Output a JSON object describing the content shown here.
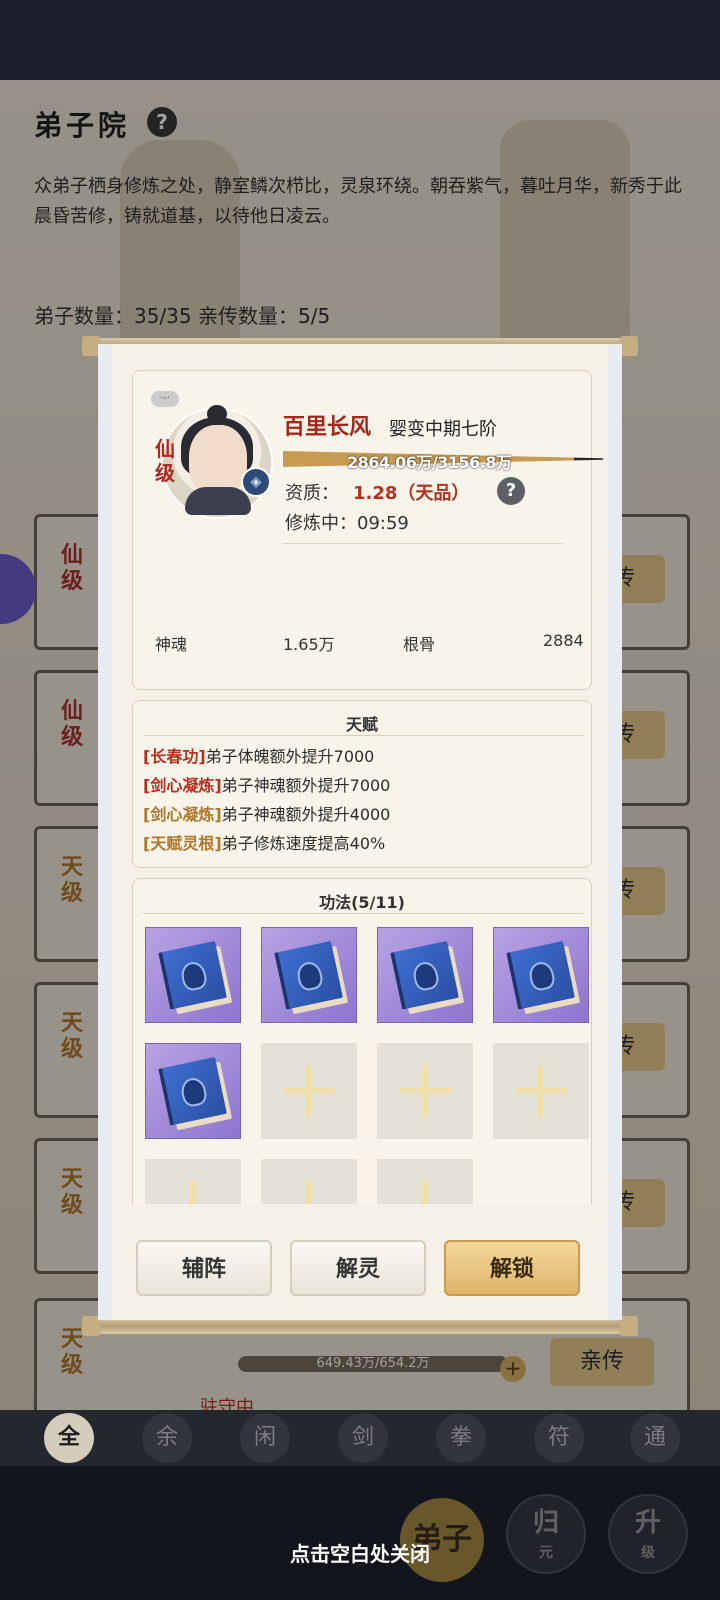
{
  "background": {
    "title": "弟子院",
    "description": "众弟子栖身修炼之处，静室鳞次栉比，灵泉环绕。朝吞紫气，暮吐月华，新秀于此晨昏苦修，铸就道基，以待他日凌云。",
    "count_text": "弟子数量：35/35   亲传数量：5/5",
    "cards": [
      {
        "rank": "仙级",
        "button": "亲传"
      },
      {
        "rank": "仙级",
        "button": "亲传"
      },
      {
        "rank": "天级",
        "button": "亲传"
      },
      {
        "rank": "天级",
        "button": "亲传"
      },
      {
        "rank": "天级",
        "button": "亲传"
      }
    ],
    "last_card": {
      "rank": "天级",
      "exp_text": "649.43万/654.2万",
      "status": "驻守中...",
      "button": "亲传"
    },
    "filters": [
      "全",
      "余",
      "闲",
      "剑",
      "拳",
      "符",
      "通"
    ],
    "bottom_nav": {
      "dizi": "弟子",
      "guiyuan": {
        "main": "归",
        "sub": "元"
      },
      "shengji": {
        "main": "升",
        "sub": "级"
      }
    },
    "close_hint": "点击空白处关闭"
  },
  "disciple": {
    "rank": "仙级",
    "name": "百里长风",
    "realm": "婴变中期七阶",
    "exp_text": "2864.06万/3156.8万",
    "exp_fraction": 0.907,
    "aptitude_label": "资质：",
    "aptitude_value": "1.28（天品）",
    "status_label": "修炼中：09:59",
    "stats": [
      {
        "label": "神魂",
        "value": "1.65万"
      },
      {
        "label": "根骨",
        "value": "2884"
      }
    ]
  },
  "talents": {
    "title": "天赋",
    "items": [
      {
        "tag": "[长春功]",
        "text": "弟子体魄额外提升7000",
        "color": "#b5301f"
      },
      {
        "tag": "[剑心凝炼]",
        "text": "弟子神魂额外提升7000",
        "color": "#b5301f"
      },
      {
        "tag": "[剑心凝炼]",
        "text": "弟子神魂额外提升4000",
        "color": "#b0762a"
      },
      {
        "tag": "[天赋灵根]",
        "text": "弟子修炼速度提高40%",
        "color": "#b0762a"
      }
    ]
  },
  "techniques": {
    "title": "功法(5/11)",
    "filled_count": 5,
    "total_slots": 11
  },
  "actions": {
    "assist": "辅阵",
    "release": "解灵",
    "unlock": "解锁"
  },
  "colors": {
    "accent_red": "#b5301f",
    "gold_button": "#deb56b",
    "slot_purple": "#8d74cf"
  }
}
